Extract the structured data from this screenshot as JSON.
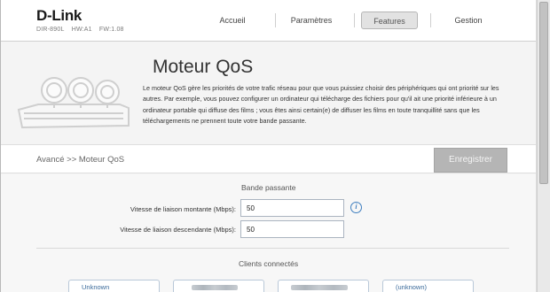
{
  "brand": {
    "logo": "D-Link",
    "model": "DIR-890L",
    "hw": "HW:A1",
    "fw": "FW:1.08"
  },
  "nav": {
    "items": [
      {
        "label": "Accueil"
      },
      {
        "label": "Paramètres"
      },
      {
        "label": "Features"
      },
      {
        "label": "Gestion"
      }
    ],
    "active": "Features"
  },
  "hero": {
    "title": "Moteur QoS",
    "description": "Le moteur QoS gère les priorités de votre trafic réseau pour que vous puissiez choisir des périphériques qui ont priorité sur les autres. Par exemple, vous pouvez configurer un ordinateur qui télécharge des fichiers pour qu'il ait une priorité inférieure à un ordinateur portable qui diffuse des films ; vous êtes ainsi certain(e) de diffuser les films en toute tranquillité sans que les téléchargements ne prennent toute votre bande passante."
  },
  "breadcrumb": "Avancé >> Moteur QoS",
  "save_label": "Enregistrer",
  "bandwidth": {
    "title": "Bande passante",
    "upload_label": "Vitesse de liaison montante (Mbps):",
    "upload_value": "50",
    "download_label": "Vitesse de liaison descendante (Mbps):",
    "download_value": "50"
  },
  "clients": {
    "title": "Clients connectés",
    "cards": [
      {
        "name": "Unknown"
      },
      {
        "name": ""
      },
      {
        "name": ""
      },
      {
        "name": "(unknown)"
      }
    ]
  },
  "colors": {
    "accent": "#3f7fbf",
    "save_button": "#b5b5b5",
    "card_border": "#b9c8d8"
  }
}
